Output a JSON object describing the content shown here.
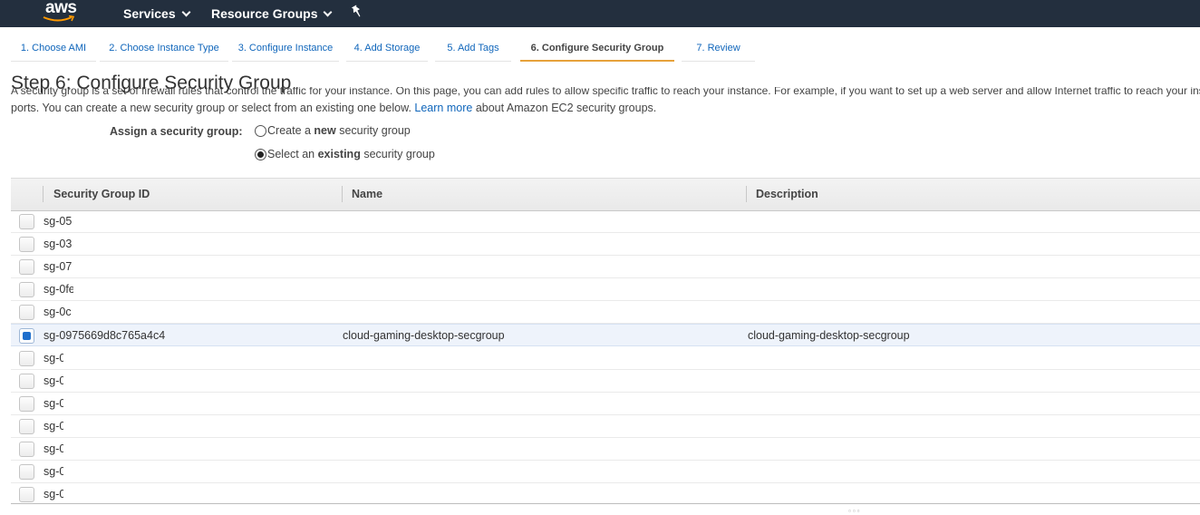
{
  "header": {
    "logo": "aws",
    "services_label": "Services",
    "resource_groups_label": "Resource Groups",
    "pin_icon": "pin-icon"
  },
  "wizard": {
    "tabs": [
      {
        "label": "1. Choose AMI",
        "active": false
      },
      {
        "label": "2. Choose Instance Type",
        "active": false
      },
      {
        "label": "3. Configure Instance",
        "active": false
      },
      {
        "label": "4. Add Storage",
        "active": false
      },
      {
        "label": "5. Add Tags",
        "active": false
      },
      {
        "label": "6. Configure Security Group",
        "active": true
      },
      {
        "label": "7. Review",
        "active": false
      }
    ]
  },
  "page": {
    "title": "Step 6: Configure Security Group",
    "intro_hidden": "A security group is a set of firewall rules that control the traffic for your instance. On this page, you can add rules to allow specific traffic to reach your instance. For example, if you want to set up a web server and allow Internet traffic to reach your instance, add rules that allow unrestricted access to the HTTP and HTTPS",
    "intro_text": "ports. You can create a new security group or select from an existing one below.",
    "learn_more": "Learn more",
    "intro_suffix": "about Amazon EC2 security groups."
  },
  "assign": {
    "label": "Assign a security group:",
    "option_create_pre": "Create a ",
    "option_create_bold": "new",
    "option_create_post": " security group",
    "option_select_pre": "Select an ",
    "option_select_bold": "existing",
    "option_select_post": " security group",
    "selected": "existing"
  },
  "table": {
    "headers": {
      "id": "Security Group ID",
      "name": "Name",
      "description": "Description"
    },
    "rows": [
      {
        "id": "sg-05",
        "name": "",
        "description": "",
        "checked": false
      },
      {
        "id": "sg-03",
        "name": "",
        "description": "",
        "checked": false
      },
      {
        "id": "sg-07",
        "name": "",
        "description": "",
        "checked": false
      },
      {
        "id": "sg-0fe",
        "name": "",
        "description": "",
        "checked": false
      },
      {
        "id": "sg-0c",
        "name": "",
        "description": "",
        "checked": false
      },
      {
        "id": "sg-0975669d8c765a4c4",
        "name": "cloud-gaming-desktop-secgroup",
        "description": "cloud-gaming-desktop-secgroup",
        "checked": true
      },
      {
        "id": "sg-0",
        "name": "",
        "description": "",
        "checked": false
      },
      {
        "id": "sg-0",
        "name": "",
        "description": "",
        "checked": false
      },
      {
        "id": "sg-0",
        "name": "",
        "description": "",
        "checked": false
      },
      {
        "id": "sg-0",
        "name": "",
        "description": "",
        "checked": false
      },
      {
        "id": "sg-0",
        "name": "",
        "description": "",
        "checked": false
      },
      {
        "id": "sg-0",
        "name": "",
        "description": "",
        "checked": false
      },
      {
        "id": "sg-0",
        "name": "",
        "description": "",
        "checked": false
      }
    ]
  },
  "colors": {
    "nav_bg": "#232f3e",
    "link": "#1066bb",
    "active_tab_underline": "#e7a23b",
    "selected_row": "#eef3fb",
    "checkbox_blue": "#1f6fcc"
  }
}
